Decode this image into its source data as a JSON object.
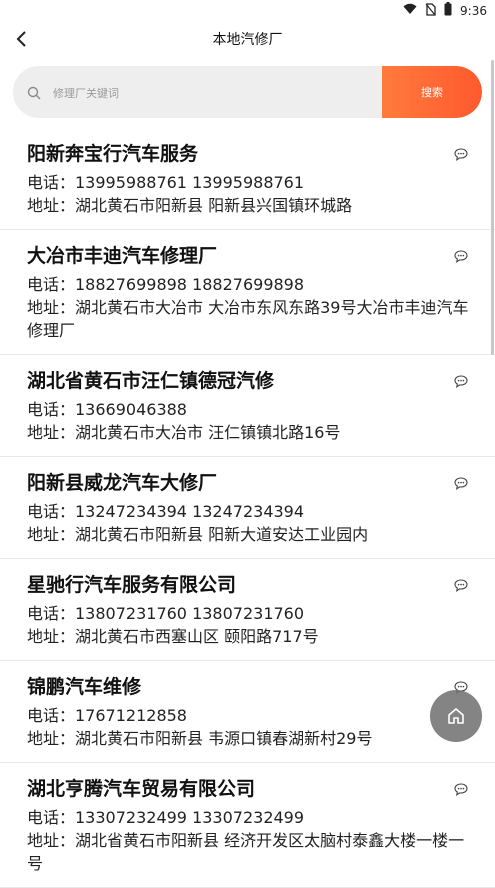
{
  "status_bar": {
    "time": "9:36"
  },
  "header": {
    "title": "本地汽修厂"
  },
  "search": {
    "placeholder": "修理厂关键词",
    "button_label": "搜索"
  },
  "shops": [
    {
      "name": "阳新奔宝行汽车服务",
      "phone": "电话：13995988761 13995988761",
      "address": "地址：湖北黄石市阳新县 阳新县兴国镇环城路"
    },
    {
      "name": "大冶市丰迪汽车修理厂",
      "phone": "电话：18827699898 18827699898",
      "address": "地址：湖北黄石市大冶市 大冶市东风东路39号大冶市丰迪汽车修理厂"
    },
    {
      "name": "湖北省黄石市汪仁镇德冠汽修",
      "phone": "电话：13669046388",
      "address": "地址：湖北黄石市大冶市 汪仁镇镇北路16号"
    },
    {
      "name": "阳新县威龙汽车大修厂",
      "phone": "电话：13247234394 13247234394",
      "address": "地址：湖北黄石市阳新县 阳新大道安达工业园内"
    },
    {
      "name": "星驰行汽车服务有限公司",
      "phone": "电话：13807231760 13807231760",
      "address": "地址：湖北黄石市西塞山区 颐阳路717号"
    },
    {
      "name": "锦鹏汽车维修",
      "phone": "电话：17671212858",
      "address": "地址：湖北黄石市阳新县 韦源口镇春湖新村29号"
    },
    {
      "name": "湖北亨腾汽车贸易有限公司",
      "phone": "电话：13307232499 13307232499",
      "address": "地址：湖北省黄石市阳新县 经济开发区太脑村泰鑫大楼一楼一号"
    }
  ]
}
